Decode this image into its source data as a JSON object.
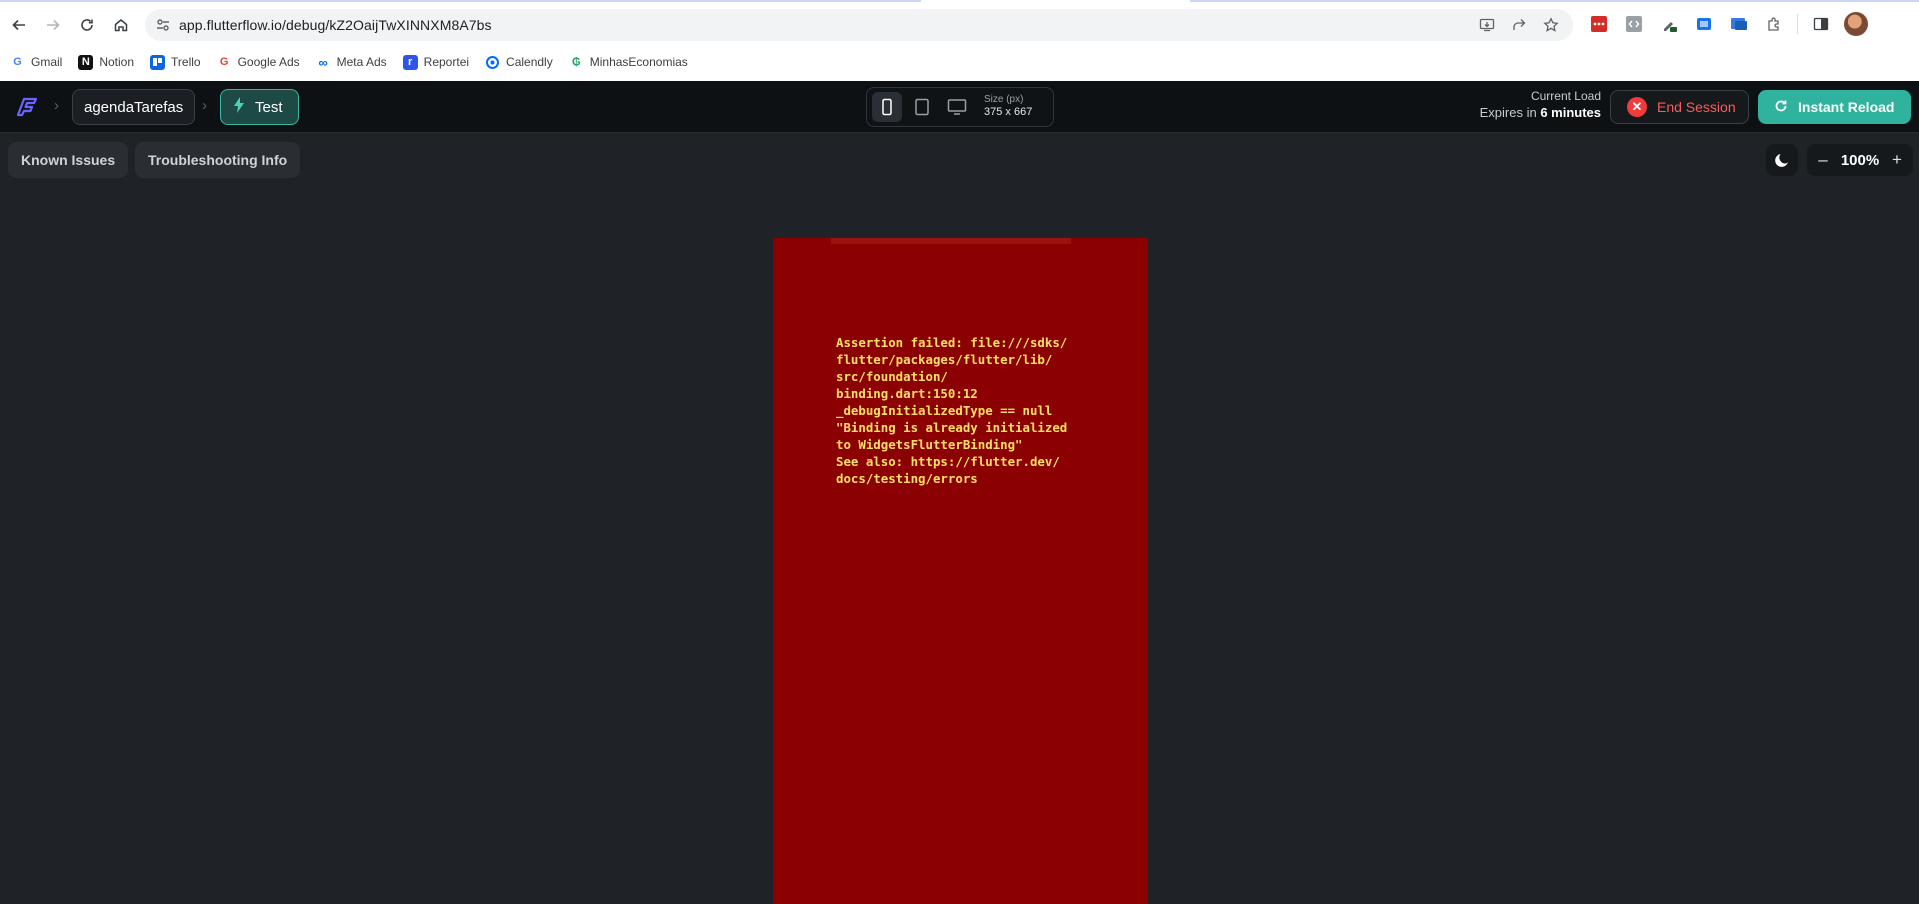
{
  "browser": {
    "url": "app.flutterflow.io/debug/kZ2OaijTwXINNXM8A7bs",
    "bookmarks": [
      {
        "label": "Gmail",
        "icon": "google-icon"
      },
      {
        "label": "Notion",
        "icon": "notion-icon"
      },
      {
        "label": "Trello",
        "icon": "trello-icon"
      },
      {
        "label": "Google Ads",
        "icon": "google-icon"
      },
      {
        "label": "Meta Ads",
        "icon": "meta-icon"
      },
      {
        "label": "Reportei",
        "icon": "reportei-icon"
      },
      {
        "label": "Calendly",
        "icon": "calendly-icon"
      },
      {
        "label": "MinhasEconomias",
        "icon": "minhaseconomias-icon"
      }
    ]
  },
  "app_bar": {
    "project_name": "agendaTarefas",
    "mode_label": "Test",
    "size_label": "Size (px)",
    "size_value": "375 x 667",
    "load_title": "Current Load",
    "expires_prefix": "Expires in",
    "expires_value": "6 minutes",
    "end_session_label": "End Session",
    "instant_reload_label": "Instant Reload",
    "colors": {
      "accent": "#2fb39e",
      "danger": "#ef3b3b",
      "background": "#0d1114"
    }
  },
  "toolbar": {
    "known_issues_label": "Known Issues",
    "troubleshooting_label": "Troubleshooting Info",
    "zoom_value": "100%"
  },
  "preview": {
    "background_color": "#8b0000",
    "text_color": "#ffe066",
    "error_lines": [
      "Assertion failed: file:///sdks/",
      "flutter/packages/flutter/lib/",
      "src/foundation/",
      "binding.dart:150:12",
      "_debugInitializedType == null",
      "\"Binding is already initialized",
      "to WidgetsFlutterBinding\"",
      "See also: https://flutter.dev/",
      "docs/testing/errors"
    ]
  }
}
